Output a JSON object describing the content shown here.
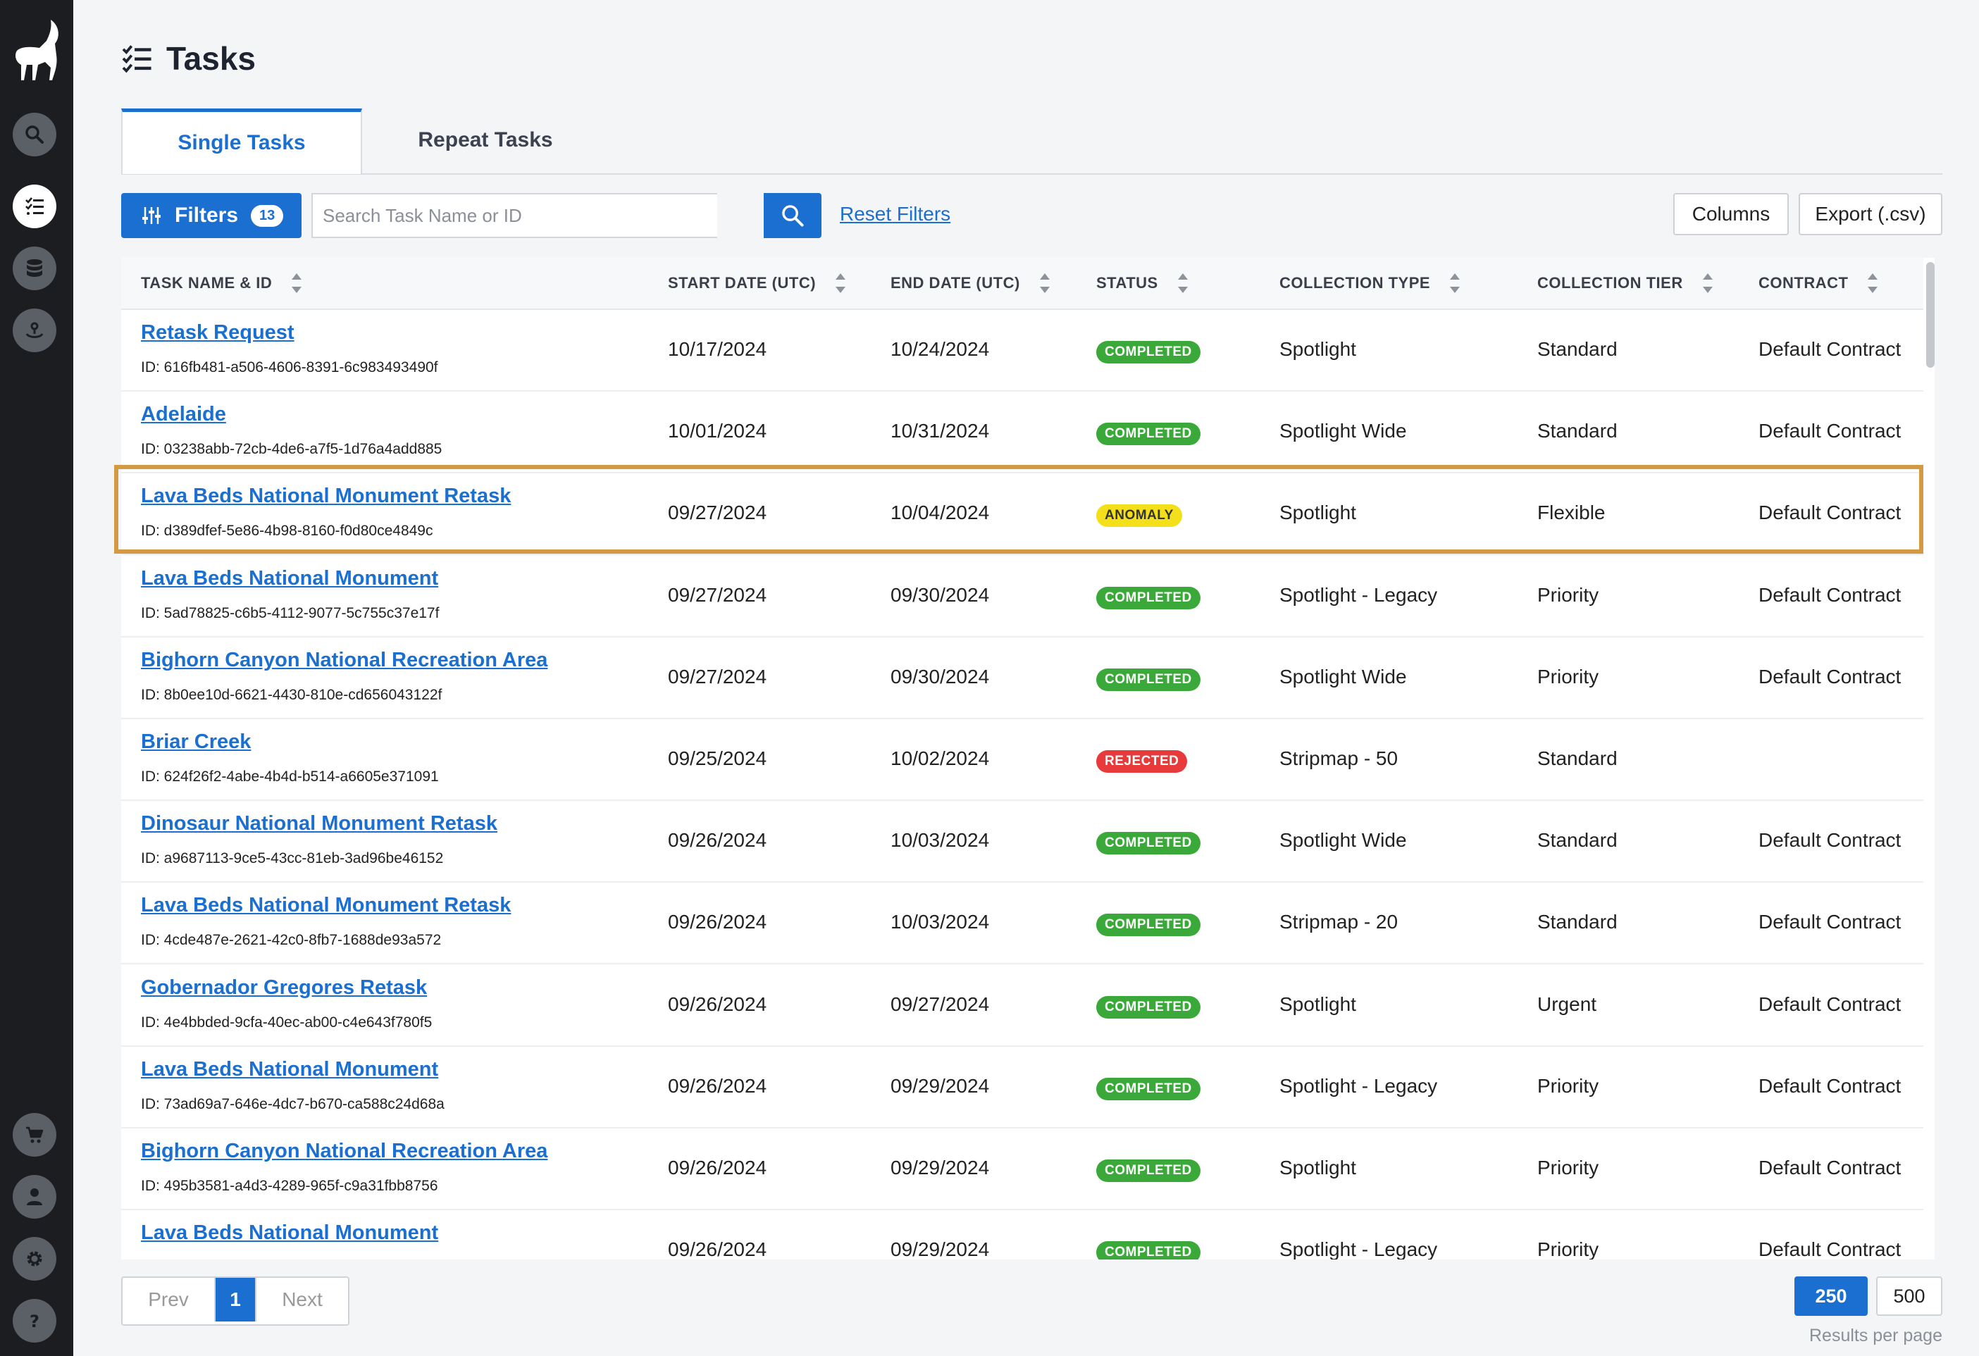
{
  "page": {
    "title": "Tasks"
  },
  "tabs": [
    {
      "label": "Single Tasks",
      "active": true
    },
    {
      "label": "Repeat Tasks",
      "active": false
    }
  ],
  "toolbar": {
    "filters_label": "Filters",
    "filters_count": "13",
    "search_placeholder": "Search Task Name or ID",
    "reset_label": "Reset Filters",
    "columns_label": "Columns",
    "export_label": "Export (.csv)"
  },
  "table": {
    "headers": {
      "task": "TASK NAME & ID",
      "start": "START DATE (UTC)",
      "end": "END DATE (UTC)",
      "status": "STATUS",
      "collection_type": "COLLECTION TYPE",
      "collection_tier": "COLLECTION TIER",
      "contract": "CONTRACT"
    },
    "rows": [
      {
        "name": "Retask Request",
        "id": "ID: 616fb481-a506-4606-8391-6c983493490f",
        "start": "10/17/2024",
        "end": "10/24/2024",
        "status": "COMPLETED",
        "type": "Spotlight",
        "tier": "Standard",
        "contract": "Default Contract"
      },
      {
        "name": "Adelaide",
        "id": "ID: 03238abb-72cb-4de6-a7f5-1d76a4add885",
        "start": "10/01/2024",
        "end": "10/31/2024",
        "status": "COMPLETED",
        "type": "Spotlight Wide",
        "tier": "Standard",
        "contract": "Default Contract"
      },
      {
        "name": "Lava Beds National Monument Retask",
        "id": "ID: d389dfef-5e86-4b98-8160-f0d80ce4849c",
        "start": "09/27/2024",
        "end": "10/04/2024",
        "status": "ANOMALY",
        "type": "Spotlight",
        "tier": "Flexible",
        "contract": "Default Contract"
      },
      {
        "name": "Lava Beds National Monument",
        "id": "ID: 5ad78825-c6b5-4112-9077-5c755c37e17f",
        "start": "09/27/2024",
        "end": "09/30/2024",
        "status": "COMPLETED",
        "type": "Spotlight - Legacy",
        "tier": "Priority",
        "contract": "Default Contract"
      },
      {
        "name": "Bighorn Canyon National Recreation Area",
        "id": "ID: 8b0ee10d-6621-4430-810e-cd656043122f",
        "start": "09/27/2024",
        "end": "09/30/2024",
        "status": "COMPLETED",
        "type": "Spotlight Wide",
        "tier": "Priority",
        "contract": "Default Contract"
      },
      {
        "name": "Briar Creek",
        "id": "ID: 624f26f2-4abe-4b4d-b514-a6605e371091",
        "start": "09/25/2024",
        "end": "10/02/2024",
        "status": "REJECTED",
        "type": "Stripmap - 50",
        "tier": "Standard",
        "contract": ""
      },
      {
        "name": "Dinosaur National Monument Retask",
        "id": "ID: a9687113-9ce5-43cc-81eb-3ad96be46152",
        "start": "09/26/2024",
        "end": "10/03/2024",
        "status": "COMPLETED",
        "type": "Spotlight Wide",
        "tier": "Standard",
        "contract": "Default Contract"
      },
      {
        "name": "Lava Beds National Monument Retask",
        "id": "ID: 4cde487e-2621-42c0-8fb7-1688de93a572",
        "start": "09/26/2024",
        "end": "10/03/2024",
        "status": "COMPLETED",
        "type": "Stripmap - 20",
        "tier": "Standard",
        "contract": "Default Contract"
      },
      {
        "name": "Gobernador Gregores Retask",
        "id": "ID: 4e4bbded-9cfa-40ec-ab00-c4e643f780f5",
        "start": "09/26/2024",
        "end": "09/27/2024",
        "status": "COMPLETED",
        "type": "Spotlight",
        "tier": "Urgent",
        "contract": "Default Contract"
      },
      {
        "name": "Lava Beds National Monument",
        "id": "ID: 73ad69a7-646e-4dc7-b670-ca588c24d68a",
        "start": "09/26/2024",
        "end": "09/29/2024",
        "status": "COMPLETED",
        "type": "Spotlight - Legacy",
        "tier": "Priority",
        "contract": "Default Contract"
      },
      {
        "name": "Bighorn Canyon National Recreation Area",
        "id": "ID: 495b3581-a4d3-4289-965f-c9a31fbb8756",
        "start": "09/26/2024",
        "end": "09/29/2024",
        "status": "COMPLETED",
        "type": "Spotlight",
        "tier": "Priority",
        "contract": "Default Contract"
      },
      {
        "name": "Lava Beds National Monument",
        "id": "",
        "start": "09/26/2024",
        "end": "09/29/2024",
        "status": "COMPLETED",
        "type": "Spotlight - Legacy",
        "tier": "Priority",
        "contract": "Default Contract"
      }
    ]
  },
  "pagination": {
    "prev": "Prev",
    "current": "1",
    "next": "Next"
  },
  "results_per_page": {
    "options": [
      "250",
      "500"
    ],
    "selected": "250",
    "label": "Results per page"
  },
  "colors": {
    "accent": "#1a6fd0",
    "completed": "#3aa93a",
    "anomaly": "#f3e01b",
    "rejected": "#e83a3a",
    "highlight": "#d39a43"
  }
}
